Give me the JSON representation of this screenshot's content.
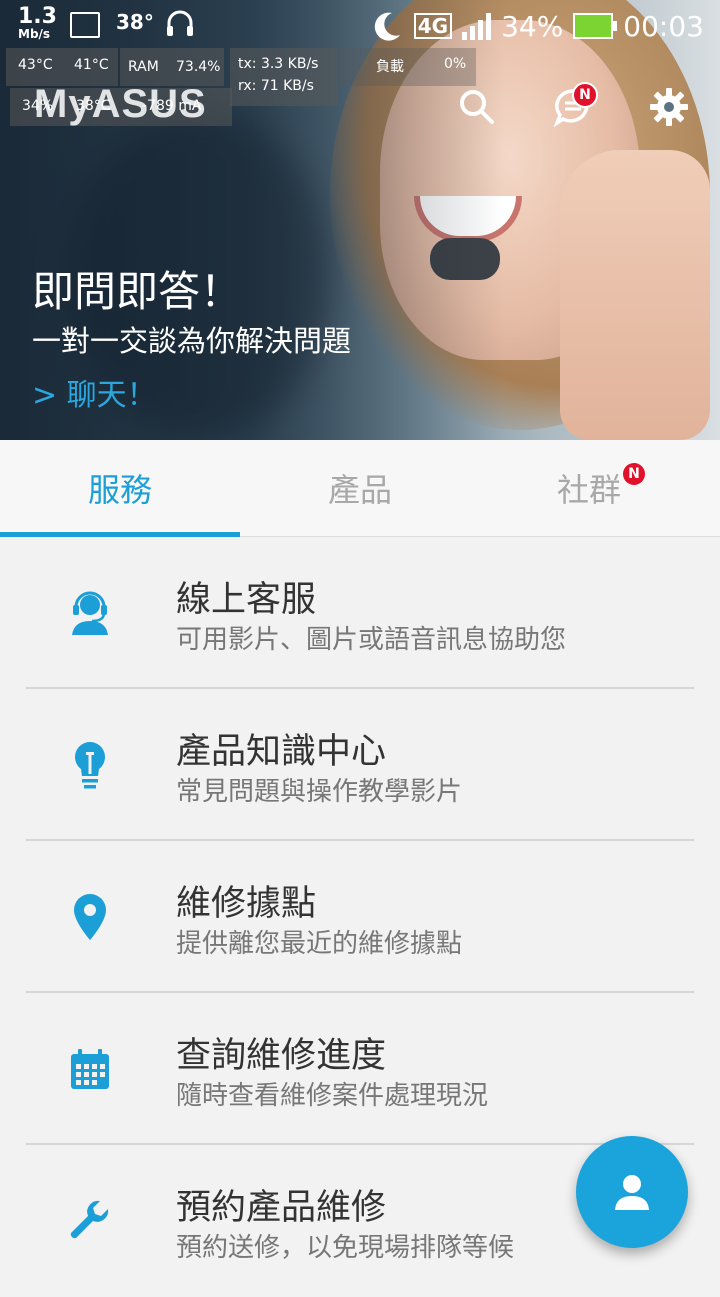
{
  "status_bar": {
    "net_speed": "1.3",
    "net_unit": "Mb/s",
    "temp": "38°",
    "network": "4G",
    "battery": "34%",
    "time": "00:03"
  },
  "overlay": {
    "cpu_temp": "43°C",
    "cpu_temp2": "41°C",
    "ram_label": "RAM",
    "ram_value": "73.4%",
    "tx": "tx: 3.3 KB/s",
    "rx": "rx: 71 KB/s",
    "load_label": "負載",
    "load_value": "0%",
    "batt_pct": "34%",
    "batt_temp": "38°C",
    "batt_current": "-789 mA"
  },
  "header": {
    "app_title": "MyASUS",
    "notif_badge": "N"
  },
  "hero": {
    "headline": "即問即答！",
    "subtitle": "一對一交談為你解決問題",
    "link": "> 聊天！"
  },
  "tabs": [
    {
      "label": "服務",
      "active": true
    },
    {
      "label": "產品",
      "active": false
    },
    {
      "label": "社群",
      "active": false,
      "badge": "N"
    }
  ],
  "services": [
    {
      "title": "線上客服",
      "subtitle": "可用影片、圖片或語音訊息協助您",
      "icon": "headset-icon"
    },
    {
      "title": "產品知識中心",
      "subtitle": "常見問題與操作教學影片",
      "icon": "lightbulb-icon"
    },
    {
      "title": "維修據點",
      "subtitle": "提供離您最近的維修據點",
      "icon": "location-pin-icon"
    },
    {
      "title": "查詢維修進度",
      "subtitle": "隨時查看維修案件處理現況",
      "icon": "calendar-icon"
    },
    {
      "title": "預約產品維修",
      "subtitle": "預約送修，以免現場排隊等候",
      "icon": "wrench-icon"
    }
  ],
  "colors": {
    "accent": "#1b9fd6",
    "badge": "#e0112b"
  }
}
